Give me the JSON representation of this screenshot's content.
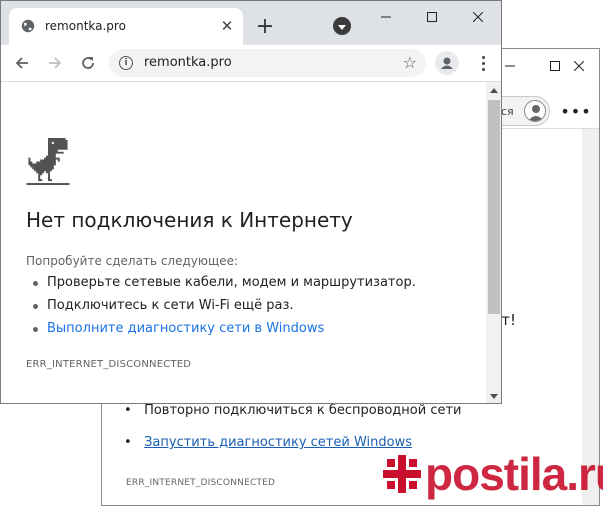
{
  "back_window": {
    "profile_label": "ся",
    "partial_text": "ет!",
    "bullets": [
      "Повторно подключиться к беспроводной сети",
      "Запустить диагностику сетей Windows"
    ],
    "error_code": "ERR_INTERNET_DISCONNECTED"
  },
  "front_window": {
    "tab_title": "remontka.pro",
    "new_tab_label": "+",
    "address": "remontka.pro",
    "page": {
      "headline": "Нет подключения к Интернету",
      "try_label": "Попробуйте сделать следующее:",
      "suggestions": [
        "Проверьте сетевые кабели, модем и маршрутизатор.",
        "Подключитесь к сети Wi-Fi ещё раз.",
        "Выполните диагностику сети в Windows"
      ],
      "error_code": "ERR_INTERNET_DISCONNECTED"
    }
  },
  "watermark": {
    "text": "postila.ru",
    "color": "#c8102e"
  },
  "colors": {
    "link": "#1a73e8",
    "tabstrip": "#dee1e6"
  }
}
